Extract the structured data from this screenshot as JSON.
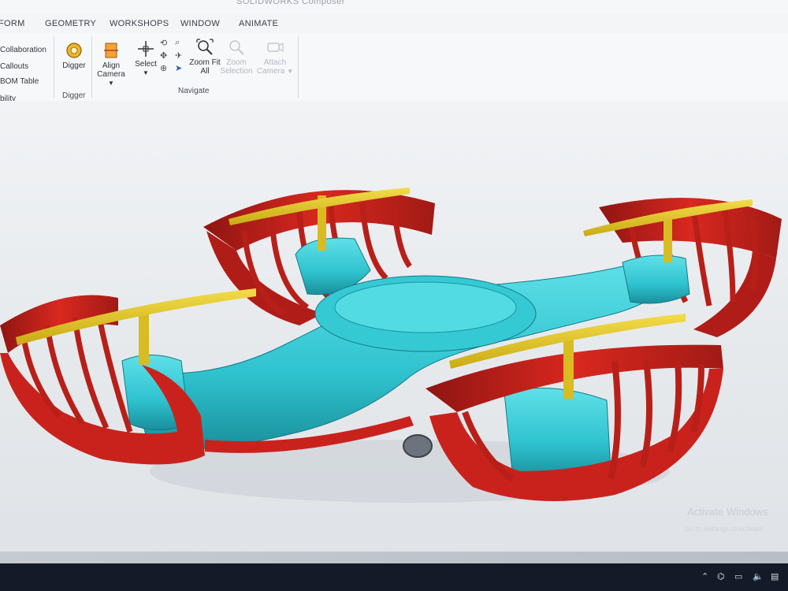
{
  "window": {
    "title": "SOLIDWORKS Composer"
  },
  "menu": {
    "items": [
      "FORM",
      "GEOMETRY",
      "WORKSHOPS",
      "WINDOW",
      "ANIMATE"
    ]
  },
  "ribbon": {
    "left_items": [
      "Collaboration",
      "Callouts",
      "BOM Table",
      "bility"
    ],
    "digger": {
      "button_label": "Digger",
      "group_label": "Digger"
    },
    "navigate": {
      "group_label": "Navigate",
      "align_camera_label": "Align Camera",
      "select_label": "Select",
      "zoom_fit_all_label": "Zoom Fit All",
      "zoom_selection_label": "Zoom Selection",
      "attach_camera_label": "Attach Camera"
    }
  },
  "viewport": {
    "model": "drone-assembly",
    "colors": {
      "body": "#2fc3cf",
      "guards": "#c9221d",
      "propellers": "#e3c72a"
    }
  },
  "watermark": {
    "line1": "Activate Windows",
    "line2": "Go to Settings to activate"
  },
  "colors": {
    "ribbon_bg": "#f7f8fa",
    "taskbar": "#151a28",
    "viewport_top": "#f1f3f5"
  }
}
